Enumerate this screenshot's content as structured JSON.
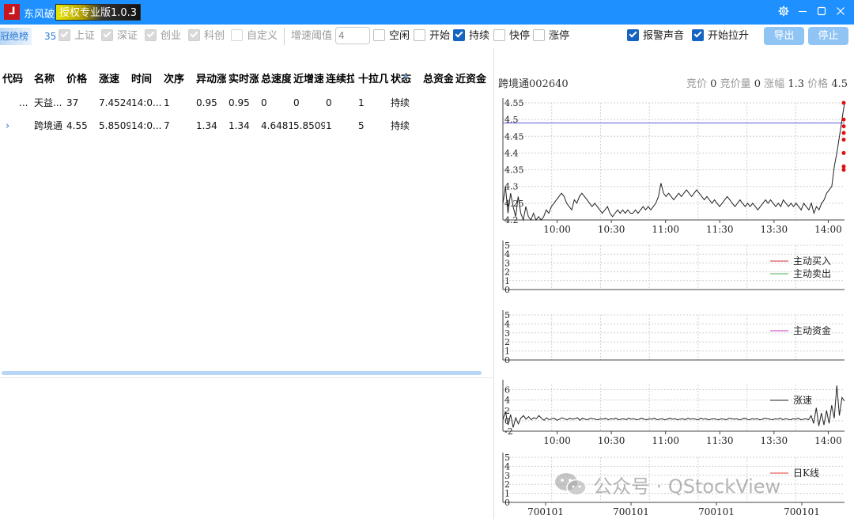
{
  "titlebar": {
    "icon_glyph": "⅃",
    "app_name": "东风破",
    "license_badge": "授权专业版1.0.3",
    "settings_icon": "gear-icon",
    "minimize_icon": "minimize-icon",
    "maximize_icon": "maximize-icon",
    "close_icon": "close-icon"
  },
  "toolbar": {
    "list_name": "冠绝榜",
    "count": "35",
    "markets": [
      {
        "label": "上证",
        "checked": true,
        "enabled": false
      },
      {
        "label": "深证",
        "checked": true,
        "enabled": false
      },
      {
        "label": "创业",
        "checked": true,
        "enabled": false
      },
      {
        "label": "科创",
        "checked": true,
        "enabled": false
      },
      {
        "label": "自定义",
        "checked": false,
        "enabled": false
      }
    ],
    "threshold_label": "增速阈值",
    "threshold_value": "4",
    "filters": [
      {
        "label": "空闲",
        "checked": false
      },
      {
        "label": "开始",
        "checked": false
      },
      {
        "label": "持续",
        "checked": true
      },
      {
        "label": "快停",
        "checked": false
      },
      {
        "label": "涨停",
        "checked": false
      }
    ],
    "alarm_sound": {
      "label": "报警声音",
      "checked": true
    },
    "start_rise": {
      "label": "开始拉升",
      "checked": true
    },
    "export_label": "导出",
    "stop_label": "停止"
  },
  "table": {
    "columns": [
      "代码",
      "名称",
      "价格",
      "涨速",
      "时间",
      "次序",
      "异动涨",
      "实时涨",
      "总速度",
      "近增速",
      "连续拉",
      "十拉几",
      "状态",
      "总资金",
      "近资金"
    ],
    "rows": [
      {
        "selected": false,
        "code": "...",
        "name": "天益...",
        "price": "37",
        "speed": "7.4524",
        "time": "14:0...",
        "order": "1",
        "abn": "0.95",
        "rt": "0.95",
        "total_speed": "0",
        "near_speed": "0",
        "cont": "0",
        "ten": "1",
        "status": "持续",
        "total_funds": "",
        "near_funds": ""
      },
      {
        "selected": true,
        "code": "",
        "name": "跨境通",
        "price": "4.55",
        "speed": "5.8509",
        "time": "14:0...",
        "order": "7",
        "abn": "1.34",
        "rt": "1.34",
        "total_speed": "4.6481",
        "near_speed": "5.8509",
        "cont": "1",
        "ten": "5",
        "status": "持续",
        "total_funds": "",
        "near_funds": ""
      }
    ]
  },
  "stock": {
    "title": "跨境通002640",
    "bid_label": "竞价",
    "bid_value": "0",
    "bid_vol_label": "竞价量",
    "bid_vol_value": "0",
    "change_label": "涨幅",
    "change_value": "1.3",
    "price_label": "价格",
    "price_value": "4.5"
  },
  "chart_data": [
    {
      "type": "line",
      "name": "price-intraday",
      "x_tick_labels": [
        "10:00",
        "10:30",
        "11:00",
        "11:30",
        "13:30",
        "14:00"
      ],
      "y_tick_labels": [
        "4.2",
        "4.25",
        "4.3",
        "4.35",
        "4.4",
        "4.45",
        "4.5",
        "4.55"
      ],
      "ylim": [
        4.2,
        4.55
      ],
      "reference_line": 4.49,
      "reference_color": "#5b5bd6",
      "line_color": "#222222",
      "marker_color": "#e01010",
      "grid": true,
      "series": [
        {
          "values": [
            4.25,
            4.3,
            4.22,
            4.28,
            4.24,
            4.21,
            4.27,
            4.22,
            4.2,
            4.24,
            4.21,
            4.2,
            4.22,
            4.2,
            4.21,
            4.2,
            4.21,
            4.23,
            4.22,
            4.24,
            4.25,
            4.26,
            4.27,
            4.28,
            4.27,
            4.25,
            4.24,
            4.23,
            4.26,
            4.25,
            4.27,
            4.28,
            4.27,
            4.26,
            4.25,
            4.24,
            4.25,
            4.24,
            4.23,
            4.22,
            4.23,
            4.24,
            4.22,
            4.21,
            4.22,
            4.23,
            4.22,
            4.23,
            4.22,
            4.23,
            4.22,
            4.22,
            4.23,
            4.22,
            4.23,
            4.24,
            4.23,
            4.24,
            4.23,
            4.24,
            4.25,
            4.27,
            4.31,
            4.28,
            4.27,
            4.28,
            4.27,
            4.26,
            4.27,
            4.28,
            4.27,
            4.28,
            4.29,
            4.28,
            4.27,
            4.28,
            4.29,
            4.28,
            4.27,
            4.26,
            4.27,
            4.26,
            4.25,
            4.26,
            4.25,
            4.24,
            4.25,
            4.26,
            4.27,
            4.26,
            4.25,
            4.24,
            4.25,
            4.26,
            4.25,
            4.24,
            4.25,
            4.24,
            4.25,
            4.24,
            4.23,
            4.24,
            4.25,
            4.26,
            4.25,
            4.26,
            4.25,
            4.24,
            4.25,
            4.24,
            4.26,
            4.25,
            4.24,
            4.25,
            4.24,
            4.25,
            4.24,
            4.23,
            4.25,
            4.24,
            4.23,
            4.25,
            4.22,
            4.24,
            4.23,
            4.25,
            4.26,
            4.28,
            4.29,
            4.3,
            4.36,
            4.4,
            4.45,
            4.5,
            4.55
          ]
        }
      ],
      "markers": [
        4.35,
        4.36,
        4.4,
        4.44,
        4.46,
        4.48,
        4.5,
        4.55
      ]
    },
    {
      "type": "line",
      "name": "active-buy-sell",
      "y_tick_labels": [
        "0",
        "1",
        "2",
        "3",
        "4",
        "5"
      ],
      "ylim": [
        0,
        5
      ],
      "grid": true,
      "legend": "right",
      "series": [
        {
          "name": "主动买入",
          "color": "#d32f2f",
          "values": []
        },
        {
          "name": "主动卖出",
          "color": "#4caf50",
          "values": []
        }
      ]
    },
    {
      "type": "line",
      "name": "active-funds",
      "y_tick_labels": [
        "0",
        "1",
        "2",
        "3",
        "4",
        "5"
      ],
      "ylim": [
        0,
        5
      ],
      "grid": true,
      "legend": "right",
      "series": [
        {
          "name": "主动资金",
          "color": "#c030c0",
          "values": []
        }
      ]
    },
    {
      "type": "line",
      "name": "speed",
      "x_tick_labels": [
        "10:00",
        "10:30",
        "11:00",
        "11:30",
        "13:30",
        "14:00"
      ],
      "y_tick_labels": [
        "-2",
        "0",
        "2",
        "4",
        "6"
      ],
      "ylim": [
        -2,
        7
      ],
      "grid": true,
      "legend": "right",
      "series": [
        {
          "name": "涨速",
          "color": "#222222",
          "values": [
            0.2,
            1.8,
            -0.8,
            1.2,
            -1.3,
            0.6,
            -0.6,
            0.5,
            1.0,
            0.3,
            0.8,
            0.2,
            0.6,
            0.4,
            1.0,
            0.5,
            0.1,
            0.6,
            0.2,
            0.4,
            0.5,
            0.1,
            0.3,
            0.6,
            0.4,
            0.2,
            0.5,
            0.3,
            0.4,
            0.6,
            0.1,
            0.5,
            0.3,
            0.2,
            0.5,
            0.4,
            0.3,
            0.2,
            0.4,
            0.3,
            0.5,
            0.2,
            0.4,
            0.3,
            0.5,
            0.2,
            0.3,
            0.4,
            0.2,
            0.5,
            0.3,
            0.4,
            0.2,
            0.3,
            0.5,
            0.3,
            0.2,
            0.4,
            0.3,
            0.5,
            0.2,
            0.3,
            0.4,
            0.2,
            0.3,
            0.5,
            0.3,
            0.4,
            0.2,
            0.3,
            0.4,
            0.2,
            0.5,
            0.3,
            0.4,
            0.3,
            0.2,
            0.5,
            0.3,
            0.4,
            0.2,
            0.3,
            0.4,
            0.3,
            0.2,
            0.4,
            0.3,
            0.2,
            0.5,
            0.4,
            0.3,
            0.4,
            0.2,
            0.3,
            0.5,
            0.3,
            0.2,
            0.4,
            0.3,
            0.4,
            0.2,
            0.3,
            0.5,
            0.4,
            0.3,
            0.2,
            0.4,
            0.3,
            0.5,
            0.2,
            0.4,
            0.3,
            0.2,
            0.4,
            0.3,
            0.5,
            0.2,
            0.3,
            0.4,
            0.2,
            1.0,
            -0.5,
            2.5,
            -1.0,
            1.5,
            -0.8,
            2.0,
            -0.5,
            3.0,
            0.5,
            6.8,
            1.0,
            4.5,
            3.8
          ]
        }
      ]
    },
    {
      "type": "line",
      "name": "daily-k",
      "x_tick_labels": [
        "700101",
        "700101",
        "700101",
        "700101"
      ],
      "y_tick_labels": [
        "0",
        "1",
        "2",
        "3",
        "4",
        "5"
      ],
      "ylim": [
        0,
        5
      ],
      "grid": true,
      "legend": "right",
      "series": [
        {
          "name": "日K线",
          "color": "#e53935",
          "values": []
        }
      ]
    }
  ],
  "watermark": {
    "icon": "wechat-icon",
    "text": "公众号 · QStockView"
  }
}
